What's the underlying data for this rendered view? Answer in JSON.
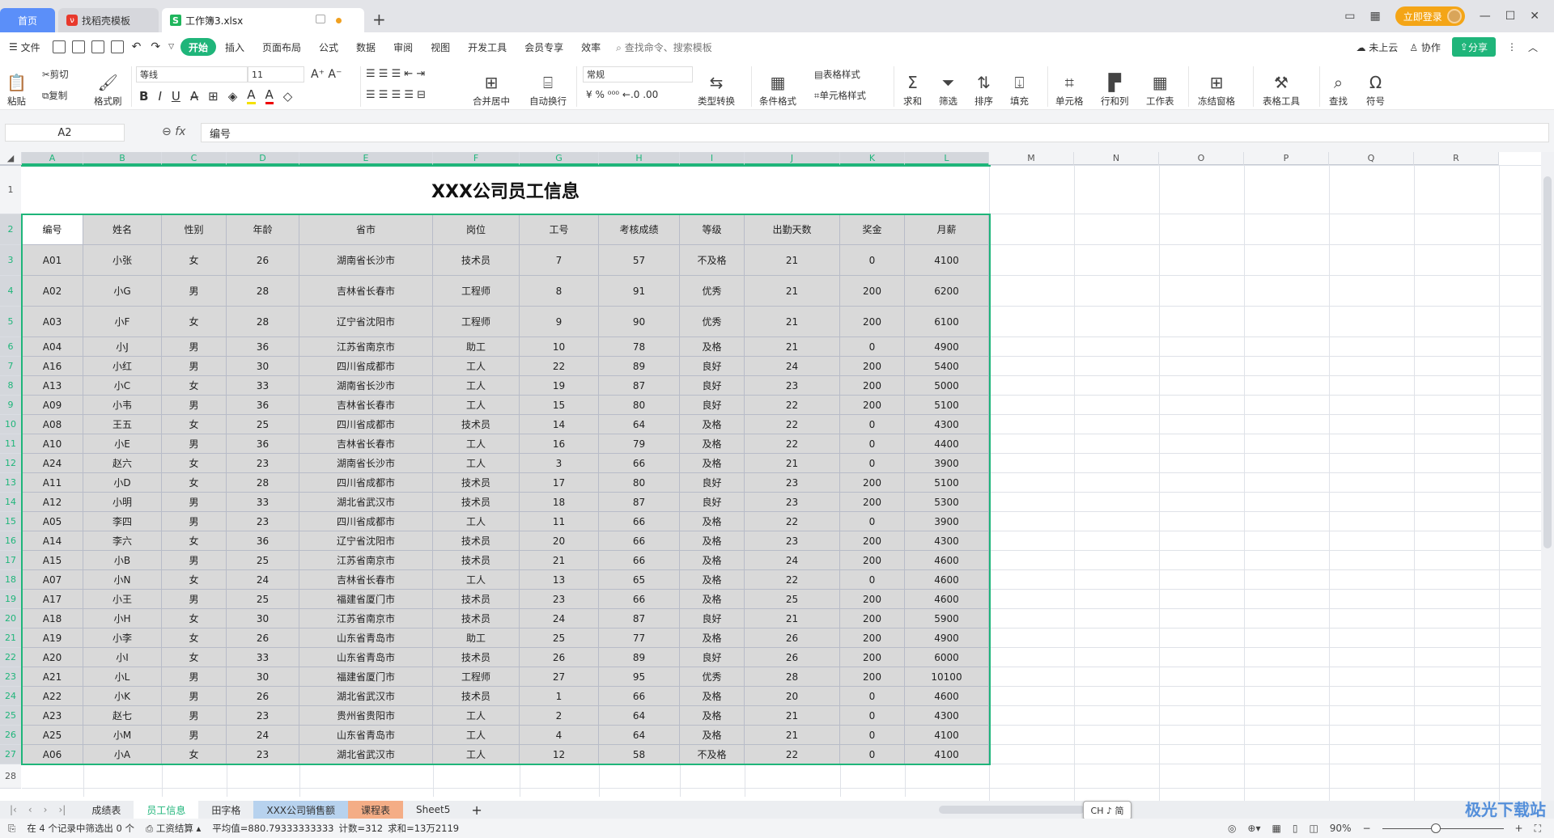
{
  "titlebar": {
    "tabs": [
      {
        "label": "首页"
      },
      {
        "label": "找稻壳模板"
      },
      {
        "label": "工作簿3.xlsx"
      }
    ],
    "login_label": "立即登录"
  },
  "menubar": {
    "file_label": "文件",
    "items": [
      "开始",
      "插入",
      "页面布局",
      "公式",
      "数据",
      "审阅",
      "视图",
      "开发工具",
      "会员专享",
      "效率"
    ],
    "search_placeholder": "查找命令、搜索模板",
    "cloud_label": "未上云",
    "collab_label": "协作",
    "share_label": "分享"
  },
  "ribbon": {
    "paste": "粘贴",
    "cut": "剪切",
    "copy": "复制",
    "format_painter": "格式刷",
    "font_name": "等线",
    "font_size": "11",
    "merge_center": "合并居中",
    "wrap_text": "自动换行",
    "number_format": "常规",
    "type_convert": "类型转换",
    "cond_format": "条件格式",
    "table_style": "表格样式",
    "cell_style": "单元格样式",
    "sum": "求和",
    "filter": "筛选",
    "sort": "排序",
    "fill": "填充",
    "cell": "单元格",
    "row_col": "行和列",
    "worksheet": "工作表",
    "freeze": "冻结窗格",
    "table_tools": "表格工具",
    "find": "查找",
    "symbol": "符号"
  },
  "formula_bar": {
    "name_box": "A2",
    "fx_label": "fx",
    "content": "编号"
  },
  "grid": {
    "columns": [
      "A",
      "B",
      "C",
      "D",
      "E",
      "F",
      "G",
      "H",
      "I",
      "J",
      "K",
      "L",
      "M",
      "N",
      "O",
      "P",
      "Q",
      "R"
    ],
    "title": "XXX公司员工信息",
    "headers": [
      "编号",
      "姓名",
      "性别",
      "年龄",
      "省市",
      "岗位",
      "工号",
      "考核成绩",
      "等级",
      "出勤天数",
      "奖金",
      "月薪"
    ],
    "rows": [
      [
        "A01",
        "小张",
        "女",
        "26",
        "湖南省长沙市",
        "技术员",
        "7",
        "57",
        "不及格",
        "21",
        "0",
        "4100"
      ],
      [
        "A02",
        "小G",
        "男",
        "28",
        "吉林省长春市",
        "工程师",
        "8",
        "91",
        "优秀",
        "21",
        "200",
        "6200"
      ],
      [
        "A03",
        "小F",
        "女",
        "28",
        "辽宁省沈阳市",
        "工程师",
        "9",
        "90",
        "优秀",
        "21",
        "200",
        "6100"
      ],
      [
        "A04",
        "小J",
        "男",
        "36",
        "江苏省南京市",
        "助工",
        "10",
        "78",
        "及格",
        "21",
        "0",
        "4900"
      ],
      [
        "A16",
        "小红",
        "男",
        "30",
        "四川省成都市",
        "工人",
        "22",
        "89",
        "良好",
        "24",
        "200",
        "5400"
      ],
      [
        "A13",
        "小C",
        "女",
        "33",
        "湖南省长沙市",
        "工人",
        "19",
        "87",
        "良好",
        "23",
        "200",
        "5000"
      ],
      [
        "A09",
        "小韦",
        "男",
        "36",
        "吉林省长春市",
        "工人",
        "15",
        "80",
        "良好",
        "22",
        "200",
        "5100"
      ],
      [
        "A08",
        "王五",
        "女",
        "25",
        "四川省成都市",
        "技术员",
        "14",
        "64",
        "及格",
        "22",
        "0",
        "4300"
      ],
      [
        "A10",
        "小E",
        "男",
        "36",
        "吉林省长春市",
        "工人",
        "16",
        "79",
        "及格",
        "22",
        "0",
        "4400"
      ],
      [
        "A24",
        "赵六",
        "女",
        "23",
        "湖南省长沙市",
        "工人",
        "3",
        "66",
        "及格",
        "21",
        "0",
        "3900"
      ],
      [
        "A11",
        "小D",
        "女",
        "28",
        "四川省成都市",
        "技术员",
        "17",
        "80",
        "良好",
        "23",
        "200",
        "5100"
      ],
      [
        "A12",
        "小明",
        "男",
        "33",
        "湖北省武汉市",
        "技术员",
        "18",
        "87",
        "良好",
        "23",
        "200",
        "5300"
      ],
      [
        "A05",
        "李四",
        "男",
        "23",
        "四川省成都市",
        "工人",
        "11",
        "66",
        "及格",
        "22",
        "0",
        "3900"
      ],
      [
        "A14",
        "李六",
        "女",
        "36",
        "辽宁省沈阳市",
        "技术员",
        "20",
        "66",
        "及格",
        "23",
        "200",
        "4300"
      ],
      [
        "A15",
        "小B",
        "男",
        "25",
        "江苏省南京市",
        "技术员",
        "21",
        "66",
        "及格",
        "24",
        "200",
        "4600"
      ],
      [
        "A07",
        "小N",
        "女",
        "24",
        "吉林省长春市",
        "工人",
        "13",
        "65",
        "及格",
        "22",
        "0",
        "4600"
      ],
      [
        "A17",
        "小王",
        "男",
        "25",
        "福建省厦门市",
        "技术员",
        "23",
        "66",
        "及格",
        "25",
        "200",
        "4600"
      ],
      [
        "A18",
        "小H",
        "女",
        "30",
        "江苏省南京市",
        "技术员",
        "24",
        "87",
        "良好",
        "21",
        "200",
        "5900"
      ],
      [
        "A19",
        "小李",
        "女",
        "26",
        "山东省青岛市",
        "助工",
        "25",
        "77",
        "及格",
        "26",
        "200",
        "4900"
      ],
      [
        "A20",
        "小I",
        "女",
        "33",
        "山东省青岛市",
        "技术员",
        "26",
        "89",
        "良好",
        "26",
        "200",
        "6000"
      ],
      [
        "A21",
        "小L",
        "男",
        "30",
        "福建省厦门市",
        "工程师",
        "27",
        "95",
        "优秀",
        "28",
        "200",
        "10100"
      ],
      [
        "A22",
        "小K",
        "男",
        "26",
        "湖北省武汉市",
        "技术员",
        "1",
        "66",
        "及格",
        "20",
        "0",
        "4600"
      ],
      [
        "A23",
        "赵七",
        "男",
        "23",
        "贵州省贵阳市",
        "工人",
        "2",
        "64",
        "及格",
        "21",
        "0",
        "4300"
      ],
      [
        "A25",
        "小M",
        "男",
        "24",
        "山东省青岛市",
        "工人",
        "4",
        "64",
        "及格",
        "21",
        "0",
        "4100"
      ],
      [
        "A06",
        "小A",
        "女",
        "23",
        "湖北省武汉市",
        "工人",
        "12",
        "58",
        "不及格",
        "22",
        "0",
        "4100"
      ]
    ]
  },
  "sheet_tabs": [
    {
      "label": "成绩表",
      "style": ""
    },
    {
      "label": "员工信息",
      "style": "active"
    },
    {
      "label": "田字格",
      "style": ""
    },
    {
      "label": "XXX公司销售额",
      "style": "blue"
    },
    {
      "label": "课程表",
      "style": "orange"
    },
    {
      "label": "Sheet5",
      "style": ""
    }
  ],
  "ime_indicator": "CH ♪ 简",
  "status": {
    "filter_info": "在 4 个记录中筛选出 0 个",
    "macro_label": "工资结算",
    "average": "平均值=880.79333333333",
    "count": "计数=312",
    "sum": "求和=13万2119",
    "zoom": "90%"
  },
  "watermark": "极光下载站",
  "colors": {
    "accent": "#1fb57a",
    "selection_fill": "#d9d9d9",
    "home_tab": "#5b8ff9",
    "login": "#f4a516"
  }
}
